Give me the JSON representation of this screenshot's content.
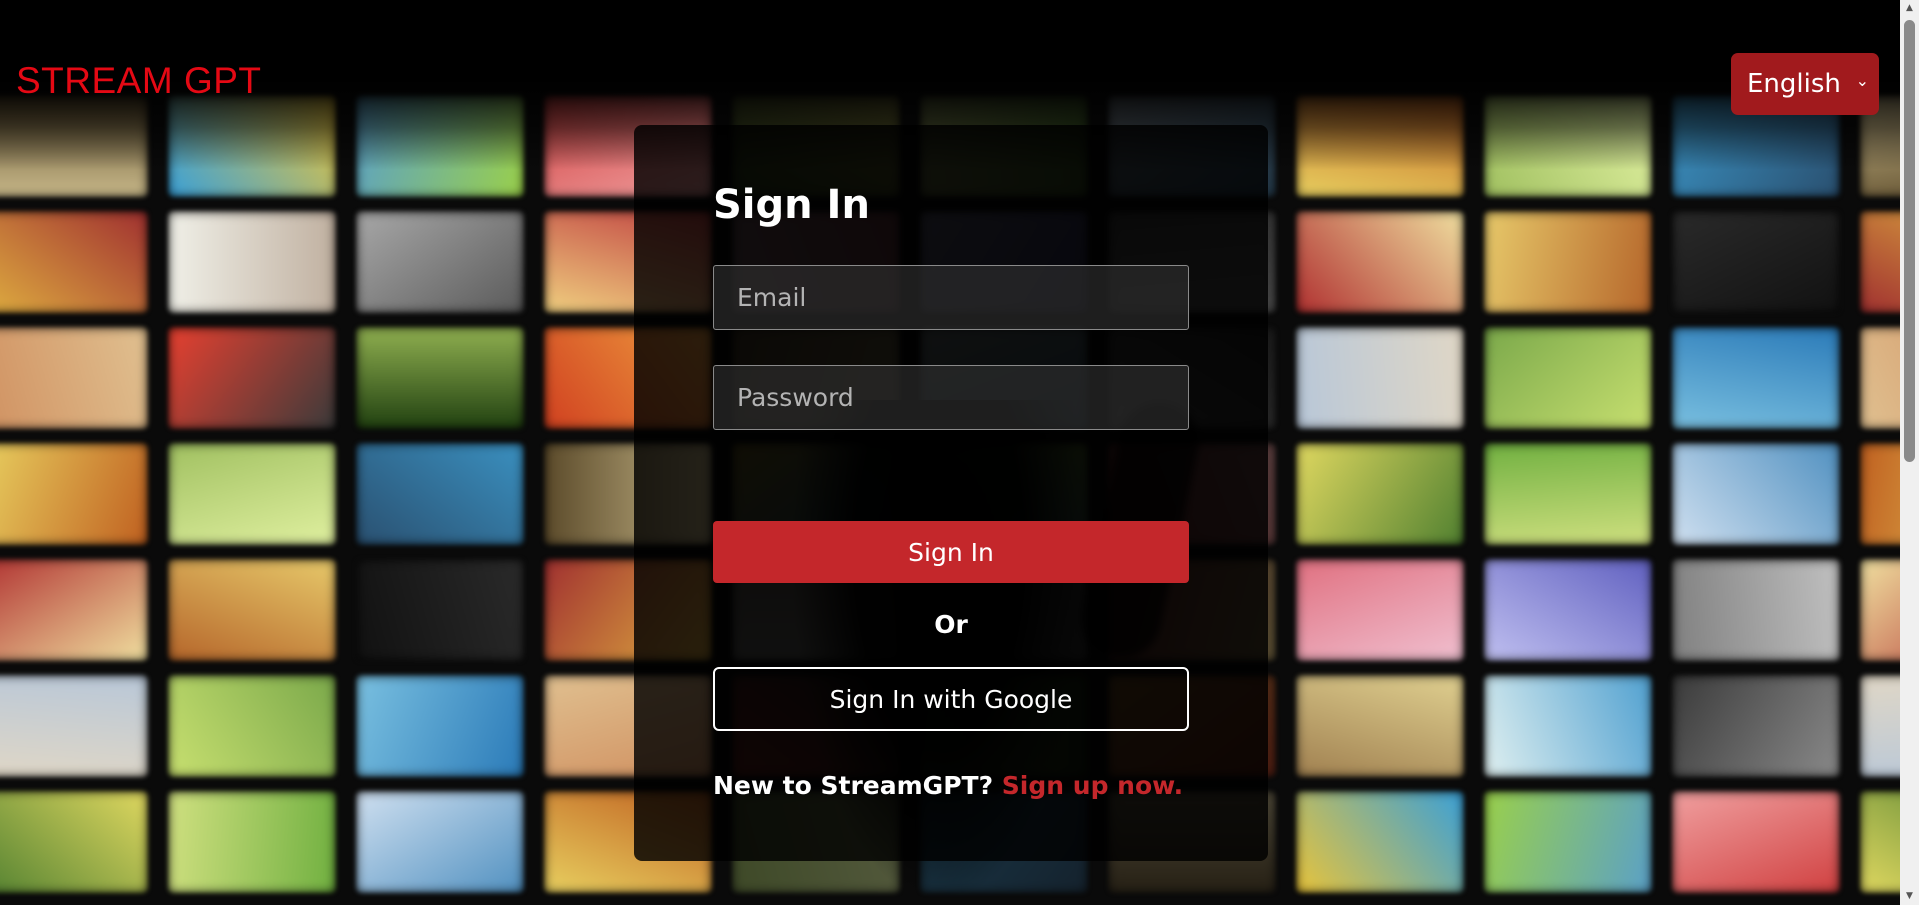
{
  "header": {
    "logo_text": "STREAM GPT",
    "language": {
      "selected": "English"
    }
  },
  "signin": {
    "title": "Sign In",
    "email_placeholder": "Email",
    "password_placeholder": "Password",
    "submit_label": "Sign In",
    "or_text": "Or",
    "google_label": "Sign In with Google",
    "new_user_text": "New to StreamGPT?",
    "signup_link": "Sign up now."
  },
  "colors": {
    "brand_red": "#e50914",
    "button_red": "#c4272b",
    "language_bg": "#a11a1d"
  },
  "icons": {
    "language_dropdown": "chevron-down-icon"
  }
}
